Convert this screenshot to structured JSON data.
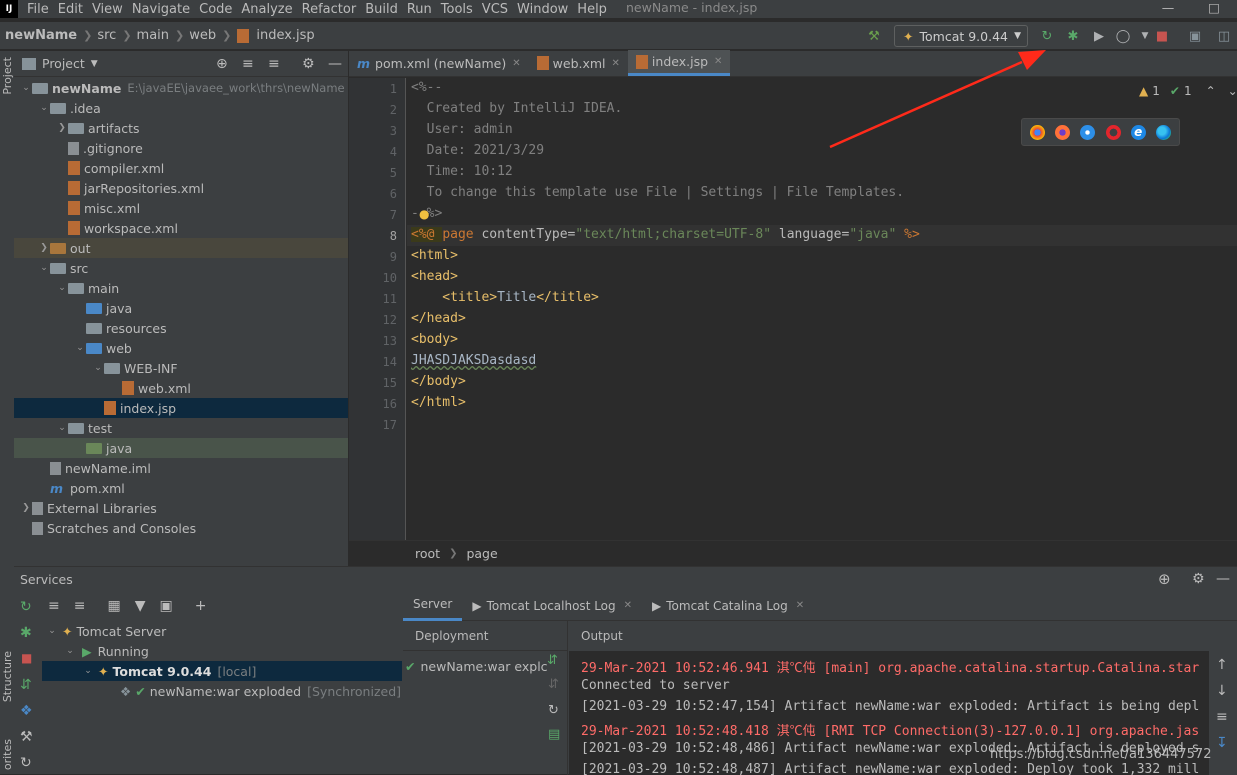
{
  "window_title": "newName - index.jsp",
  "menu": [
    "File",
    "Edit",
    "View",
    "Navigate",
    "Code",
    "Analyze",
    "Refactor",
    "Build",
    "Run",
    "Tools",
    "VCS",
    "Window",
    "Help"
  ],
  "navbar": {
    "crumbs": [
      "newName",
      "src",
      "main",
      "web",
      "index.jsp"
    ],
    "run_config": "Tomcat 9.0.44"
  },
  "project": {
    "header": "Project",
    "tree": [
      {
        "label": "newName",
        "hint": "E:\\javaEE\\javaee_work\\thrs\\newName",
        "level": 0,
        "arrow": "v",
        "icon": "folder",
        "bold": true
      },
      {
        "label": ".idea",
        "level": 1,
        "arrow": "v",
        "icon": "folder"
      },
      {
        "label": "artifacts",
        "level": 2,
        "arrow": ">",
        "icon": "folder"
      },
      {
        "label": ".gitignore",
        "level": 2,
        "arrow": "",
        "icon": "file"
      },
      {
        "label": "compiler.xml",
        "level": 2,
        "arrow": "",
        "icon": "xml"
      },
      {
        "label": "jarRepositories.xml",
        "level": 2,
        "arrow": "",
        "icon": "xml"
      },
      {
        "label": "misc.xml",
        "level": 2,
        "arrow": "",
        "icon": "xml"
      },
      {
        "label": "workspace.xml",
        "level": 2,
        "arrow": "",
        "icon": "xml"
      },
      {
        "label": "out",
        "level": 1,
        "arrow": ">",
        "icon": "orange",
        "hl": "hl1"
      },
      {
        "label": "src",
        "level": 1,
        "arrow": "v",
        "icon": "folder"
      },
      {
        "label": "main",
        "level": 2,
        "arrow": "v",
        "icon": "folder"
      },
      {
        "label": "java",
        "level": 3,
        "arrow": "",
        "icon": "blue"
      },
      {
        "label": "resources",
        "level": 3,
        "arrow": "",
        "icon": "folder"
      },
      {
        "label": "web",
        "level": 3,
        "arrow": "v",
        "icon": "blue"
      },
      {
        "label": "WEB-INF",
        "level": 4,
        "arrow": "v",
        "icon": "folder"
      },
      {
        "label": "web.xml",
        "level": 5,
        "arrow": "",
        "icon": "xml"
      },
      {
        "label": "index.jsp",
        "level": 4,
        "arrow": "",
        "icon": "xml",
        "hl": "sel"
      },
      {
        "label": "test",
        "level": 2,
        "arrow": "v",
        "icon": "folder"
      },
      {
        "label": "java",
        "level": 3,
        "arrow": "",
        "icon": "green",
        "hl": "hl2"
      },
      {
        "label": "newName.iml",
        "level": 1,
        "arrow": "",
        "icon": "file"
      },
      {
        "label": "pom.xml",
        "level": 1,
        "arrow": "",
        "icon": "m"
      },
      {
        "label": "External Libraries",
        "level": 0,
        "arrow": ">",
        "icon": "lib"
      },
      {
        "label": "Scratches and Consoles",
        "level": 0,
        "arrow": "",
        "icon": "file"
      }
    ]
  },
  "editor": {
    "tabs": [
      {
        "label": "pom.xml (newName)",
        "active": false
      },
      {
        "label": "web.xml",
        "active": false
      },
      {
        "label": "index.jsp",
        "active": true
      }
    ],
    "inspections": {
      "warnings": "1",
      "ok": "1"
    },
    "breadcrumb": [
      "root",
      "page"
    ]
  },
  "code": {
    "l1": "<%--",
    "l2": "  Created by IntelliJ IDEA.",
    "l3": "  User: admin",
    "l4": "  Date: 2021/3/29",
    "l5": "  Time: 10:12",
    "l6": "  To change this template use File | Settings | File Templates.",
    "l7": "--%>",
    "l8a": "<%@ ",
    "l8b": "page ",
    "l8c": "contentType=",
    "l8d": "\"text/html;charset=UTF-8\"",
    "l8e": " language=",
    "l8f": "\"java\"",
    "l8g": " %>",
    "l9": "<html>",
    "l10": "<head>",
    "l11a": "    <title>",
    "l11b": "Title",
    "l11c": "</title>",
    "l12": "</head>",
    "l13": "<body>",
    "l14": "JHASDJAKSDasdasd",
    "l15": "</body>",
    "l16": "</html>"
  },
  "services": {
    "title": "Services",
    "tree": [
      {
        "label": "Tomcat Server",
        "extra": ""
      },
      {
        "label": "Running",
        "extra": ""
      },
      {
        "label": "Tomcat 9.0.44",
        "extra": "[local]"
      },
      {
        "label": "newName:war exploded",
        "extra": "[Synchronized]"
      }
    ],
    "tabs": [
      "Server",
      "Tomcat Localhost Log",
      "Tomcat Catalina Log"
    ],
    "deployment_header": "Deployment",
    "deployment_item": "newName:war explc",
    "output_header": "Output",
    "output": [
      {
        "text": "29-Mar-2021 10:52:46.941 淇℃伅 [main] org.apache.catalina.startup.Catalina.star",
        "red": true
      },
      {
        "text": "Connected to server",
        "red": false
      },
      {
        "text": "[2021-03-29 10:52:47,154] Artifact newName:war exploded: Artifact is being depl",
        "red": false
      },
      {
        "text": "29-Mar-2021 10:52:48.418 淇℃伅 [RMI TCP Connection(3)-127.0.0.1] org.apache.jas",
        "red": true
      },
      {
        "text": "[2021-03-29 10:52:48,486] Artifact newName:war exploded: Artifact is deployed s",
        "red": false
      },
      {
        "text": "[2021-03-29 10:52:48,487] Artifact newName:war exploded: Deploy took 1,332 mill",
        "red": false
      }
    ]
  },
  "left_strip": {
    "project": "Project",
    "structure": "Structure",
    "favorites": "orites"
  },
  "watermark": "https://blog.csdn.net/a136447572",
  "colors": {
    "accent": "#4a88c7",
    "annotation_arrow": "#ff2a1a"
  }
}
